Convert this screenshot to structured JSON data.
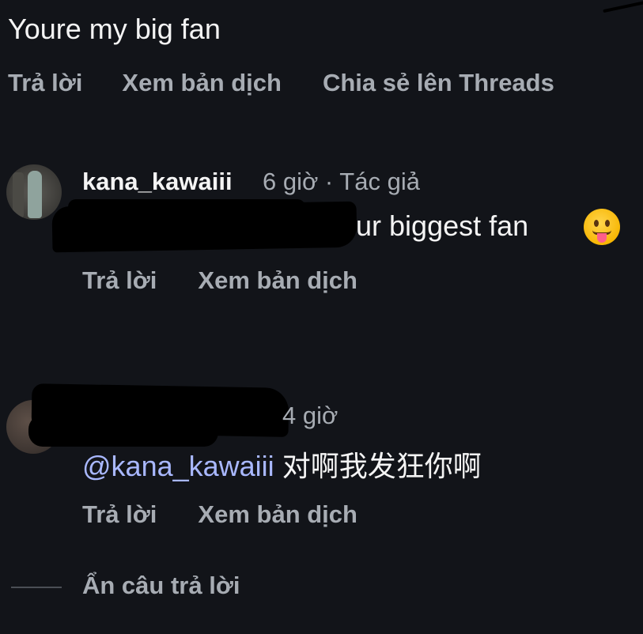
{
  "top_comment": {
    "text": "Youre my big fan",
    "actions": {
      "reply": "Trả lời",
      "translate": "Xem bản dịch",
      "share": "Chia sẻ lên Threads"
    }
  },
  "comment_1": {
    "username": "kana_kawaiii",
    "meta": "6 giờ · Tác giả",
    "text_visible": "your biggest fan",
    "emoji": "😛",
    "actions": {
      "reply": "Trả lời",
      "translate": "Xem bản dịch"
    }
  },
  "comment_2": {
    "meta": "4 giờ",
    "mention": "@kana_kawaiii",
    "text": "对啊我发狂你啊",
    "actions": {
      "reply": "Trả lời",
      "translate": "Xem bản dịch"
    }
  },
  "hide_replies": "Ẩn câu trả lời",
  "colors": {
    "background": "#121419",
    "primary_text": "#f4f4f4",
    "secondary_text": "#a7acb3",
    "mention": "#a9b8ff"
  }
}
